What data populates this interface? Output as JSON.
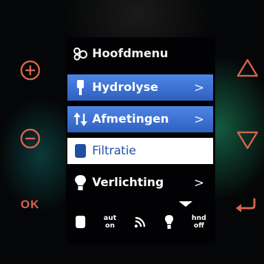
{
  "hardware": {
    "left_buttons": [
      {
        "name": "plus",
        "icon": "plus-circle-icon"
      },
      {
        "name": "minus",
        "icon": "minus-circle-icon"
      }
    ],
    "ok_label": "OK",
    "right_buttons": [
      {
        "name": "up",
        "icon": "triangle-up-icon"
      },
      {
        "name": "down",
        "icon": "triangle-down-icon"
      },
      {
        "name": "back",
        "icon": "return-arrow-icon"
      }
    ],
    "button_color": "#d9634d"
  },
  "screen": {
    "title": "Hoofdmenu",
    "title_icon": "settings-circles-icon",
    "menu": [
      {
        "label": "Hydrolyse",
        "icon": "electrode-icon",
        "state": "highlighted",
        "arrow": ">"
      },
      {
        "label": "Afmetingen",
        "icon": "up-down-arrows-icon",
        "state": "highlighted",
        "arrow": ">"
      },
      {
        "label": "Filtratie",
        "icon": "filter-icon",
        "state": "selected",
        "arrow": ""
      },
      {
        "label": "Verlichting",
        "icon": "light-bulb-icon",
        "state": "normal",
        "arrow": ">"
      }
    ],
    "status": {
      "filter_mode_top": "aut",
      "filter_mode_bottom": "on",
      "light_mode_top": "hnd",
      "light_mode_bottom": "off"
    },
    "colors": {
      "highlight": "#3f74d6",
      "selected_bg": "#ffffff",
      "selected_text": "#1f4fa3"
    }
  }
}
